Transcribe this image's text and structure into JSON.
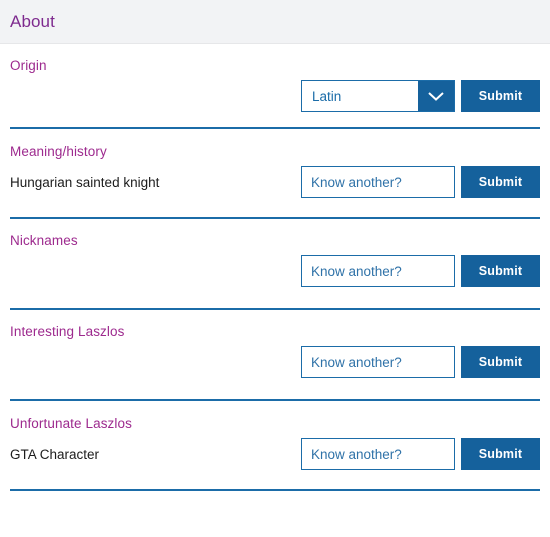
{
  "header": {
    "title": "About"
  },
  "icons": {
    "chevron_down": "chevron-down-icon"
  },
  "colors": {
    "heading_purple": "#7e2a8e",
    "label_purple": "#9d2a8e",
    "accent_blue": "#15619c",
    "border_blue": "#1b6ca8",
    "header_bg": "#f2f3f5",
    "value_text": "#1c1c1c"
  },
  "common": {
    "submit_label": "Submit",
    "input_placeholder": "Know another?",
    "input_value": ""
  },
  "sections": [
    {
      "id": "origin",
      "label": "Origin",
      "value_text": "",
      "control": "select",
      "select_value": "Latin",
      "submit_label": "Submit"
    },
    {
      "id": "meaning-history",
      "label": "Meaning/history",
      "value_text": "Hungarian sainted knight",
      "control": "input",
      "input_placeholder": "Know another?",
      "input_value": "",
      "submit_label": "Submit"
    },
    {
      "id": "nicknames",
      "label": "Nicknames",
      "value_text": "",
      "control": "input",
      "input_placeholder": "Know another?",
      "input_value": "",
      "submit_label": "Submit"
    },
    {
      "id": "interesting-laszlos",
      "label": "Interesting Laszlos",
      "value_text": "",
      "control": "input",
      "input_placeholder": "Know another?",
      "input_value": "",
      "submit_label": "Submit"
    },
    {
      "id": "unfortunate-laszlos",
      "label": "Unfortunate Laszlos",
      "value_text": "GTA Character",
      "control": "input",
      "input_placeholder": "Know another?",
      "input_value": "",
      "submit_label": "Submit"
    }
  ]
}
